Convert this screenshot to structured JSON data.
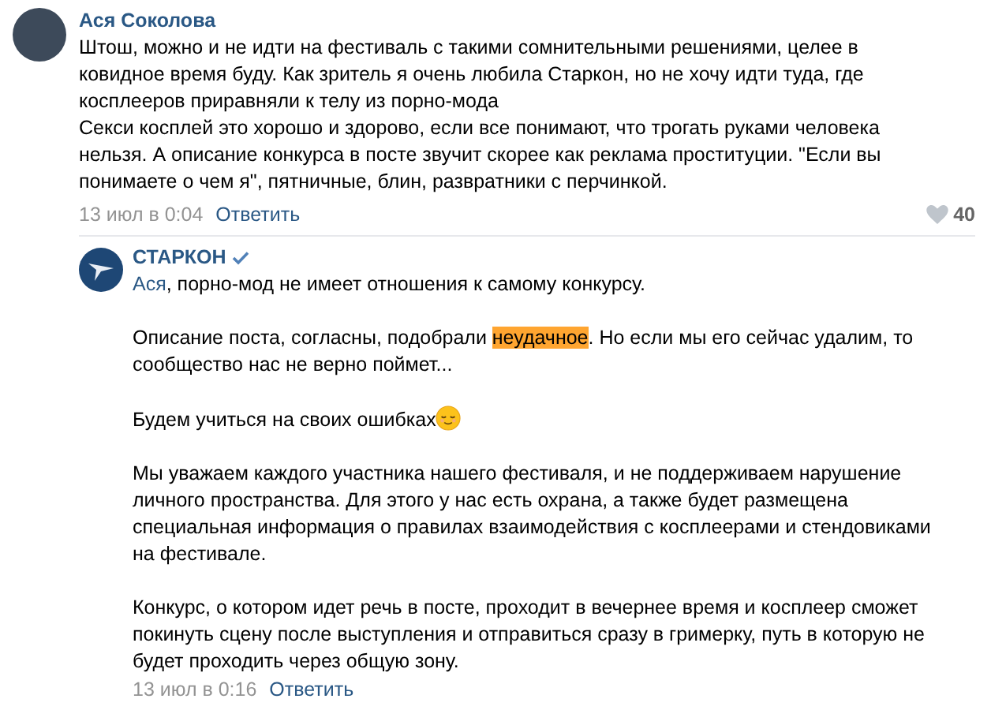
{
  "comment": {
    "author": "Ася Соколова",
    "paragraphs": [
      "Штош, можно и не идти на фестиваль с такими сомнительными решениями, целее в ковидное время буду. Как зритель я очень любила Старкон, но не хочу идти туда, где косплееров приравняли к телу из порно-мода",
      "Секси косплей это хорошо и здорово, если все понимают, что трогать руками человека нельзя. А описание конкурса в посте звучит скорее как реклама проституции. \"Если вы понимаете о чем я\", пятничные, блин, развратники с перчинкой."
    ],
    "date": "13 июл в 0:04",
    "reply_label": "Ответить",
    "likes": "40"
  },
  "reply": {
    "author": "СТАРКОН",
    "verified": true,
    "paragraphs": [
      {
        "segments": [
          {
            "kind": "mention",
            "text": "Ася"
          },
          {
            "kind": "text",
            "text": ", порно-мод не имеет отношения к самому конкурсу."
          }
        ],
        "emoji": false
      },
      {
        "segments": [
          {
            "kind": "text",
            "text": "Описание поста, согласны, подобрали "
          },
          {
            "kind": "highlight",
            "text": "неудачное"
          },
          {
            "kind": "text",
            "text": ". Но если мы его сейчас удалим, то сообщество нас не верно поймет..."
          }
        ],
        "emoji": false
      },
      {
        "segments": [
          {
            "kind": "text",
            "text": "Будем учиться на своих ошибках"
          }
        ],
        "emoji": true
      },
      {
        "segments": [
          {
            "kind": "text",
            "text": "Мы уважаем каждого участника нашего фестиваля, и не поддерживаем нарушение личного пространства. Для этого у нас есть охрана, а также будет размещена специальная информация о правилах взаимодействия с косплеерами и стендовиками на фестивале."
          }
        ],
        "emoji": false
      },
      {
        "segments": [
          {
            "kind": "text",
            "text": "Конкурс, о котором идет речь в посте, проходит в вечернее время и косплеер сможет покинуть сцену после выступления и отправиться сразу в гримерку, путь в которую не будет проходить через общую зону."
          }
        ],
        "emoji": false
      }
    ],
    "date": "13 июл в 0:16",
    "reply_label": "Ответить"
  }
}
